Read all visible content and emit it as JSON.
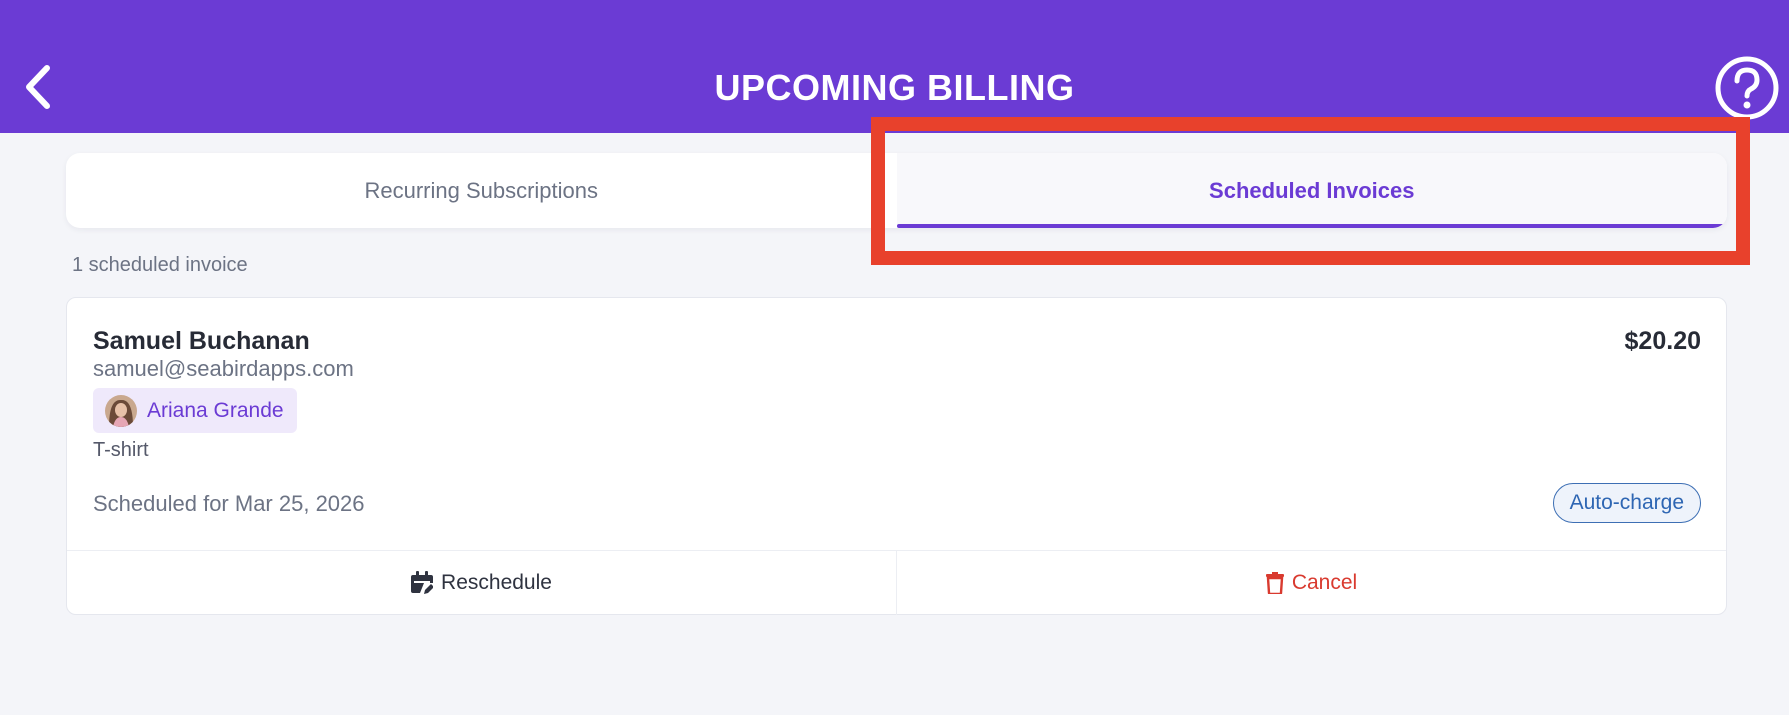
{
  "header": {
    "title": "UPCOMING BILLING",
    "back_icon": "chevron-left-icon",
    "help_icon": "question-circle-icon",
    "background_color": "#6b3bd4"
  },
  "tabs": [
    {
      "label": "Recurring Subscriptions",
      "active": false
    },
    {
      "label": "Scheduled Invoices",
      "active": true
    }
  ],
  "highlight": {
    "target": "tab-scheduled-invoices",
    "color": "#e8412c"
  },
  "summary": {
    "count_label": "1 scheduled invoice"
  },
  "invoices": [
    {
      "customer_name": "Samuel Buchanan",
      "customer_email": "samuel@seabirdapps.com",
      "amount": "$20.20",
      "artist": {
        "name": "Ariana Grande",
        "avatar_icon": "artist-avatar"
      },
      "product": "T-shirt",
      "scheduled_text": "Scheduled for Mar 25, 2026",
      "badge": "Auto-charge",
      "actions": {
        "reschedule_label": "Reschedule",
        "reschedule_icon": "calendar-edit-icon",
        "cancel_label": "Cancel",
        "cancel_icon": "trash-icon"
      }
    }
  ],
  "colors": {
    "accent": "#6b3bd4",
    "danger": "#d93a2f",
    "badge_blue": "#2e66b3"
  }
}
